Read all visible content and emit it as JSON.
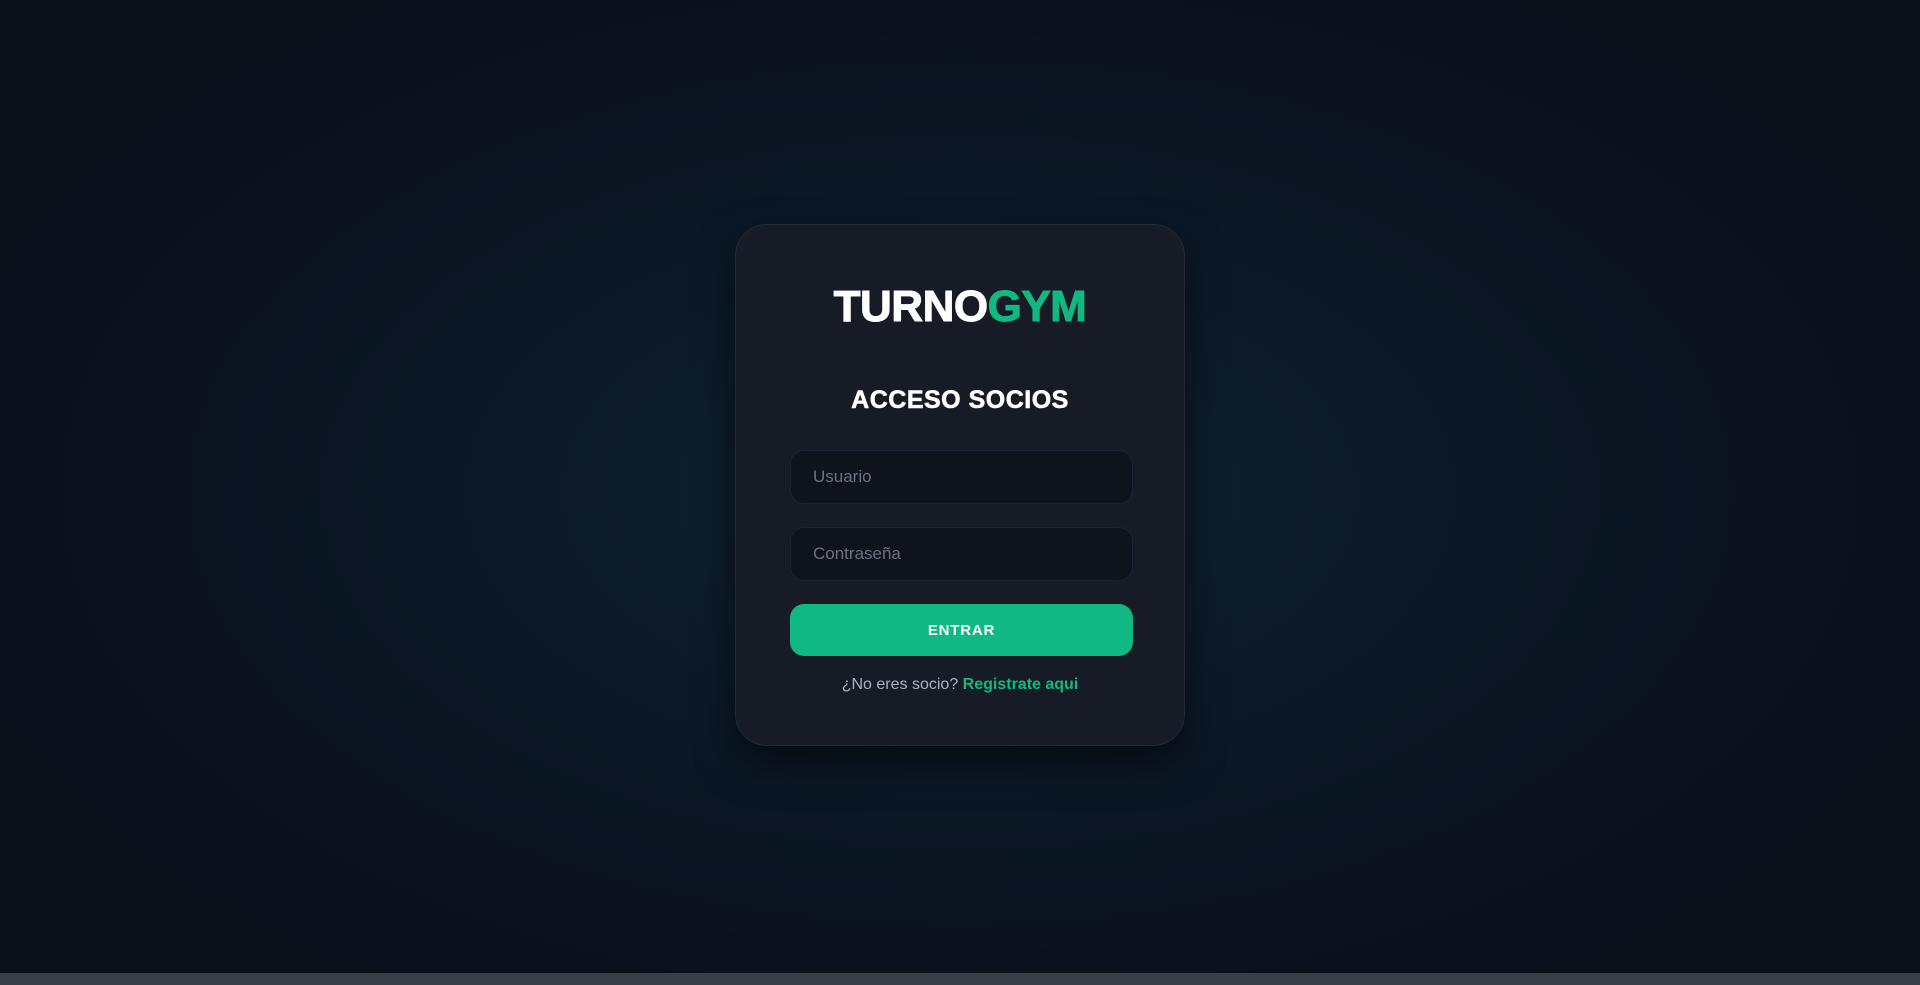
{
  "brand": {
    "part_1": "TURNO",
    "part_2": "GYM"
  },
  "login": {
    "title": "ACCESO SOCIOS",
    "username_placeholder": "Usuario",
    "password_placeholder": "Contraseña",
    "submit_label": "ENTRAR",
    "register_prompt": "¿No eres socio?",
    "register_link": "Registrate aqui"
  },
  "colors": {
    "accent": "#10b981",
    "card": "#161b26",
    "field": "#0f131c",
    "background": "#0c1927"
  }
}
